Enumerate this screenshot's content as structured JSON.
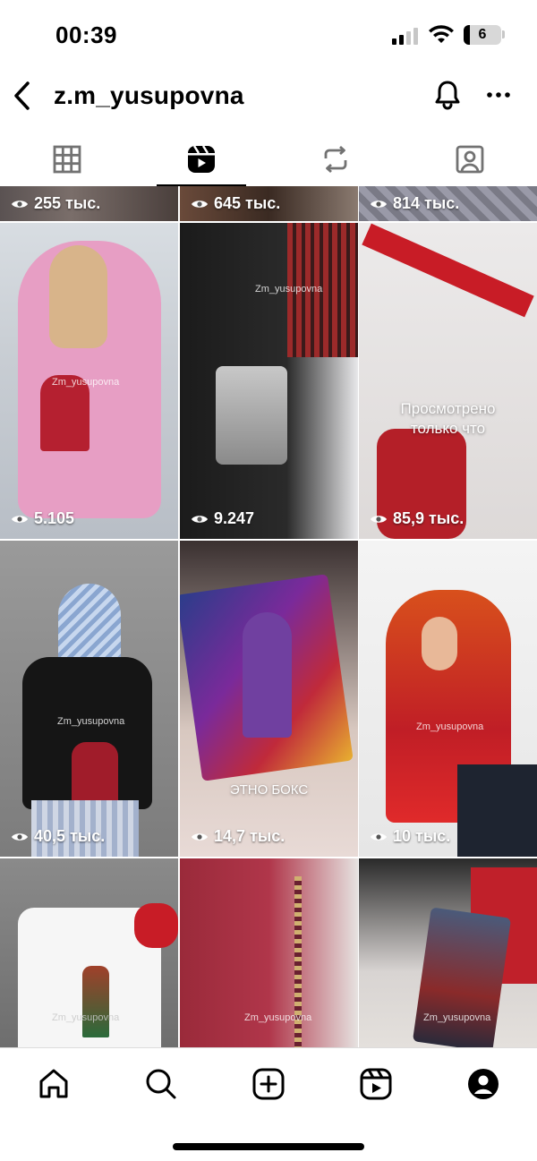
{
  "status_bar": {
    "time": "00:39",
    "battery_level": "6",
    "signal_bars_active": 2
  },
  "header": {
    "username": "z.m_yusupovna",
    "back_icon": "chevron-left-icon",
    "bell_icon": "bell-icon",
    "more_icon": "more-horizontal-icon"
  },
  "tabs": [
    {
      "name": "grid",
      "icon": "grid-icon",
      "active": false
    },
    {
      "name": "reels",
      "icon": "reels-icon",
      "active": true
    },
    {
      "name": "reposts",
      "icon": "repost-icon",
      "active": false
    },
    {
      "name": "tagged",
      "icon": "tagged-person-icon",
      "active": false
    }
  ],
  "reels": [
    {
      "views": "255 тыс."
    },
    {
      "views": "645 тыс."
    },
    {
      "views": "814 тыс."
    },
    {
      "views": "5.105",
      "watermark": "Zm_yusupovna"
    },
    {
      "views": "9.247",
      "watermark": "Zm_yusupovna"
    },
    {
      "views": "85,9 тыс.",
      "overlay": "Просмотрено только что"
    },
    {
      "views": "40,5 тыс.",
      "watermark": "Zm_yusupovna"
    },
    {
      "views": "14,7 тыс.",
      "overlay": "ЭТНО БОКС"
    },
    {
      "views": "10 тыс.",
      "watermark": "Zm_yusupovna"
    },
    {
      "views": "",
      "watermark": "Zm_yusupovna"
    },
    {
      "views": "",
      "watermark": "Zm_yusupovna"
    },
    {
      "views": "",
      "watermark": "Zm_yusupovna"
    }
  ],
  "bottom_nav": [
    {
      "name": "home",
      "icon": "home-icon"
    },
    {
      "name": "search",
      "icon": "search-icon"
    },
    {
      "name": "create",
      "icon": "plus-square-icon"
    },
    {
      "name": "reels",
      "icon": "reels-icon"
    },
    {
      "name": "profile",
      "icon": "profile-avatar-icon"
    }
  ],
  "colors": {
    "text": "#000000",
    "overlay_text": "#ffffff",
    "divider": "#dcdcdc"
  }
}
